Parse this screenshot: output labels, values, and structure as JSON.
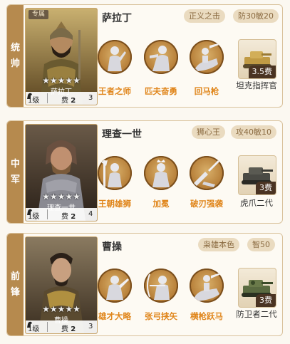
{
  "generals": [
    {
      "position": "统帅",
      "exclusive_tag": "专属",
      "stars": "★★★★★",
      "hero_label": "萨拉丁",
      "level": "1级",
      "cost_label": "费",
      "cost_count": "3",
      "cost_value": "2",
      "name": "萨拉丁",
      "trait": "正义之击",
      "stats": "防30敏20",
      "skills": [
        {
          "label": "王者之师",
          "icon": "soldier-salute-icon"
        },
        {
          "label": "匹夫奋勇",
          "icon": "warrior-charge-icon"
        },
        {
          "label": "回马枪",
          "icon": "cavalry-spear-icon"
        }
      ],
      "tank": {
        "cost": "3.5费",
        "label": "坦克指挥官",
        "icon": "desert-tank-icon"
      }
    },
    {
      "position": "中军",
      "stars": "★★★★★",
      "hero_label": "理查一世",
      "level": "1级",
      "cost_label": "费",
      "cost_value": "2",
      "cost_count": "4",
      "name": "理查一世",
      "trait": "狮心王",
      "stats": "攻40敏10",
      "skills": [
        {
          "label": "王朝雄狮",
          "icon": "halberd-knight-icon"
        },
        {
          "label": "加冕",
          "icon": "crowned-figure-icon"
        },
        {
          "label": "破刃强袭",
          "icon": "broken-blade-icon"
        }
      ],
      "tank": {
        "cost": "3费",
        "label": "虎爪二代",
        "icon": "heavy-tank-icon"
      }
    },
    {
      "position": "前锋",
      "stars": "★★★★★",
      "hero_label": "曹操",
      "level": "1级",
      "cost_label": "费",
      "cost_value": "2",
      "cost_count": "3",
      "name": "曹操",
      "trait": "枭雄本色",
      "stats": "智50",
      "skills": [
        {
          "label": "雄才大略",
          "icon": "commander-icon"
        },
        {
          "label": "张弓挟矢",
          "icon": "archer-icon"
        },
        {
          "label": "横枪跃马",
          "icon": "horse-rider-icon"
        }
      ],
      "tank": {
        "cost": "3费",
        "label": "防卫者二代",
        "icon": "camo-tank-icon"
      }
    }
  ],
  "colors": {
    "accent_orange": "#e0861c",
    "strip_brown": "#b68a4e",
    "pill_bg": "#eadbc0",
    "pill_text": "#8a6a40"
  }
}
